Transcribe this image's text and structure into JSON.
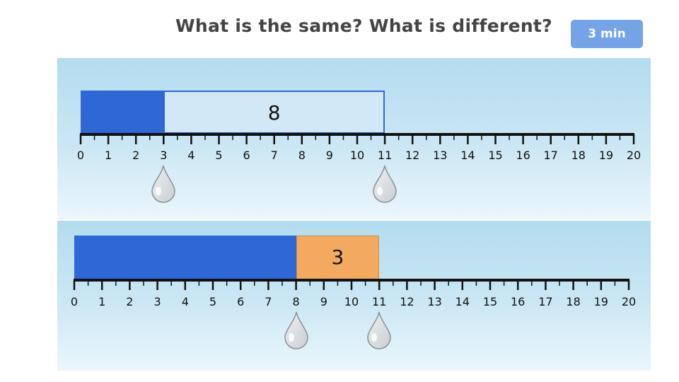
{
  "header": {
    "question": "What is the same? What is different?",
    "timer_label": "3 min"
  },
  "number_lines": [
    {
      "range": [
        0,
        20
      ],
      "bar": {
        "start": 0,
        "shaded_end": 3,
        "end": 11,
        "label": "8"
      },
      "drops_at": [
        3,
        11
      ]
    },
    {
      "range": [
        0,
        20
      ],
      "bar": {
        "start": 0,
        "shaded_end": 8,
        "end": 11,
        "label": "3"
      },
      "drops_at": [
        8,
        11
      ]
    }
  ],
  "tick_labels": [
    "0",
    "1",
    "2",
    "3",
    "4",
    "5",
    "6",
    "7",
    "8",
    "9",
    "10",
    "11",
    "12",
    "13",
    "14",
    "15",
    "16",
    "17",
    "18",
    "19",
    "20"
  ],
  "colors": {
    "shaded_blue": "#2f67d6",
    "outline_blue": "#2f67d6",
    "empty_fill": "#d2e8f6",
    "orange": "#f3aa5e",
    "drop": "#c9ced3",
    "timer": "#74a3e8"
  }
}
